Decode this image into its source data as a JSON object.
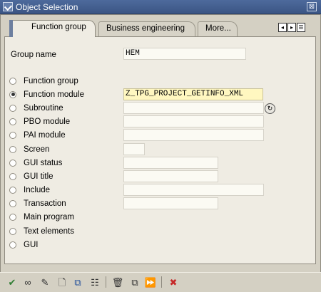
{
  "window": {
    "title": "Object Selection",
    "close_glyph": "⊠"
  },
  "tabs": [
    {
      "label": "Function group",
      "active": true
    },
    {
      "label": "Business engineering",
      "active": false
    },
    {
      "label": "More...",
      "active": false
    }
  ],
  "tab_nav": {
    "left": "◂",
    "right": "▸",
    "list": "☰"
  },
  "group_name": {
    "label": "Group name",
    "value": "HEM"
  },
  "options": [
    {
      "label": "Function group",
      "checked": false,
      "value": null
    },
    {
      "label": "Function module",
      "checked": true,
      "value": "Z_TPG_PROJECT_GETINFO_XML"
    },
    {
      "label": "Subroutine",
      "checked": false,
      "value": ""
    },
    {
      "label": "PBO module",
      "checked": false,
      "value": ""
    },
    {
      "label": "PAI module",
      "checked": false,
      "value": ""
    },
    {
      "label": "Screen",
      "checked": false,
      "value": ""
    },
    {
      "label": "GUI status",
      "checked": false,
      "value": ""
    },
    {
      "label": "GUI title",
      "checked": false,
      "value": ""
    },
    {
      "label": "Include",
      "checked": false,
      "value": ""
    },
    {
      "label": "Transaction",
      "checked": false,
      "value": ""
    },
    {
      "label": "Main program",
      "checked": false,
      "value": null
    },
    {
      "label": "Text elements",
      "checked": false,
      "value": null
    },
    {
      "label": "GUI",
      "checked": false,
      "value": null
    }
  ],
  "help_button": {
    "glyph": "↻"
  },
  "toolbar": [
    {
      "icon": "check-icon",
      "glyph": "✔",
      "color": "#2e7d32"
    },
    {
      "icon": "glasses-icon",
      "glyph": "∞",
      "color": "#333333"
    },
    {
      "icon": "pencil-icon",
      "glyph": "✎",
      "color": "#333333"
    },
    {
      "icon": "new-document-icon",
      "glyph": "🗋",
      "color": "#333333"
    },
    {
      "icon": "hierarchy-icon",
      "glyph": "⧉",
      "color": "#1f4e9a"
    },
    {
      "icon": "tree-icon",
      "glyph": "☷",
      "color": "#333333"
    },
    {
      "icon": "trash-icon",
      "glyph": "🗑",
      "color": "#333333"
    },
    {
      "icon": "copy-icon",
      "glyph": "⧉",
      "color": "#333333"
    },
    {
      "icon": "execute-icon",
      "glyph": "⏩",
      "color": "#c62828"
    },
    {
      "icon": "cancel-icon",
      "glyph": "✖",
      "color": "#c62828"
    }
  ]
}
